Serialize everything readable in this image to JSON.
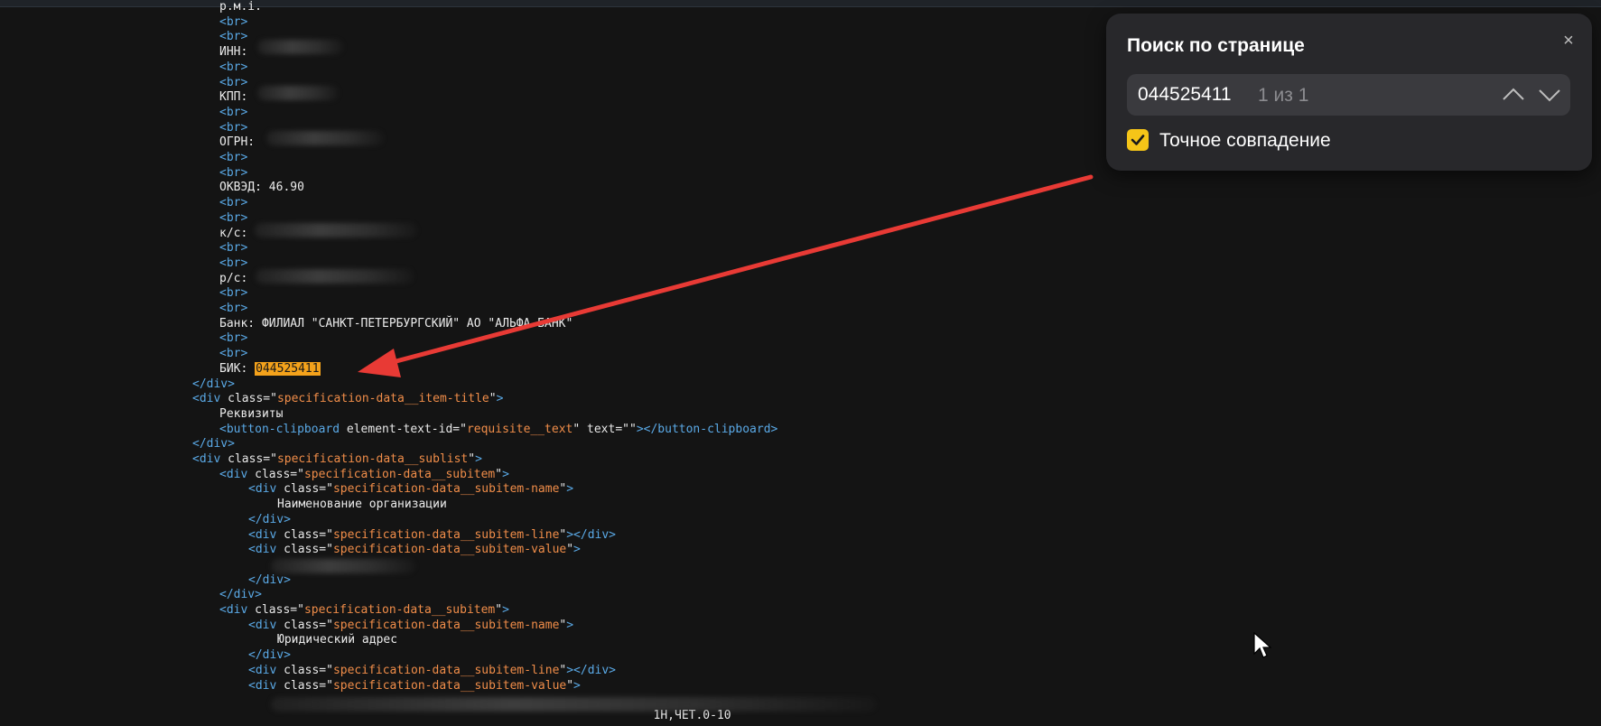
{
  "source_lines": [
    {
      "kind": "text",
      "text": "р.м.і."
    },
    {
      "kind": "br",
      "text": "<br>"
    },
    {
      "kind": "br",
      "text": "<br>"
    },
    {
      "kind": "text",
      "text": "ИНН:"
    },
    {
      "kind": "br",
      "text": "<br>"
    },
    {
      "kind": "br",
      "text": "<br>"
    },
    {
      "kind": "text",
      "text": "КПП:"
    },
    {
      "kind": "br",
      "text": "<br>"
    },
    {
      "kind": "br",
      "text": "<br>"
    },
    {
      "kind": "text",
      "text": "ОГРН:"
    },
    {
      "kind": "br",
      "text": "<br>"
    },
    {
      "kind": "br",
      "text": "<br>"
    },
    {
      "kind": "text",
      "text": "ОКВЭД: 46.90"
    },
    {
      "kind": "br",
      "text": "<br>"
    },
    {
      "kind": "br",
      "text": "<br>"
    },
    {
      "kind": "text",
      "text": "к/с:"
    },
    {
      "kind": "br",
      "text": "<br>"
    },
    {
      "kind": "br",
      "text": "<br>"
    },
    {
      "kind": "text",
      "text": "р/с:"
    },
    {
      "kind": "br",
      "text": "<br>"
    },
    {
      "kind": "br",
      "text": "<br>"
    },
    {
      "kind": "text",
      "text": "Банк: ФИЛИАЛ \"САНКТ-ПЕТЕРБУРГСКИЙ\" АО \"АЛЬФА-БАНК\""
    },
    {
      "kind": "br",
      "text": "<br>"
    },
    {
      "kind": "br",
      "text": "<br>"
    },
    {
      "kind": "bik",
      "label": "БИК: ",
      "value": "044525411"
    },
    {
      "kind": "close",
      "text": "</div>"
    },
    {
      "kind": "open",
      "tag": "div",
      "attr": "class",
      "value": "specification-data__item-title"
    },
    {
      "kind": "text",
      "text": "Реквизиты"
    },
    {
      "kind": "button",
      "tag": "button-clipboard",
      "attr1": "element-text-id",
      "value1": "requisite__text",
      "attr2": "text",
      "value2": "",
      "close": "</button-clipboard>"
    },
    {
      "kind": "close",
      "text": "</div>"
    },
    {
      "kind": "open",
      "tag": "div",
      "attr": "class",
      "value": "specification-data__sublist"
    },
    {
      "kind": "open",
      "tag": "div",
      "attr": "class",
      "value": "specification-data__subitem"
    },
    {
      "kind": "open",
      "tag": "div",
      "attr": "class",
      "value": "specification-data__subitem-name"
    },
    {
      "kind": "text",
      "text": "Наименование организации"
    },
    {
      "kind": "close",
      "text": "</div>"
    },
    {
      "kind": "openclose",
      "tag": "div",
      "attr": "class",
      "value": "specification-data__subitem-line"
    },
    {
      "kind": "open",
      "tag": "div",
      "attr": "class",
      "value": "specification-data__subitem-value"
    },
    {
      "kind": "blank",
      "text": ""
    },
    {
      "kind": "close",
      "text": "</div>"
    },
    {
      "kind": "close",
      "text": "</div>"
    },
    {
      "kind": "open",
      "tag": "div",
      "attr": "class",
      "value": "specification-data__subitem"
    },
    {
      "kind": "open",
      "tag": "div",
      "attr": "class",
      "value": "specification-data__subitem-name"
    },
    {
      "kind": "text",
      "text": "Юридический адрес"
    },
    {
      "kind": "close",
      "text": "</div>"
    },
    {
      "kind": "openclose",
      "tag": "div",
      "attr": "class",
      "value": "specification-data__subitem-line"
    },
    {
      "kind": "open",
      "tag": "div",
      "attr": "class",
      "value": "specification-data__subitem-value"
    },
    {
      "kind": "blank",
      "text": ""
    },
    {
      "kind": "text",
      "text": "                                                 1Н,ЧЕТ.0-10"
    }
  ],
  "find_panel": {
    "title": "Поиск по странице",
    "query": "044525411",
    "match_count": "1 из 1",
    "exact_match_label": "Точное совпадение",
    "exact_match_checked": true,
    "close_glyph": "×"
  },
  "colors": {
    "tag": "#5aa9e6",
    "attr_value": "#f08d49",
    "highlight": "#f4a21b",
    "checkbox": "#f5c518",
    "arrow": "#e83a35"
  }
}
